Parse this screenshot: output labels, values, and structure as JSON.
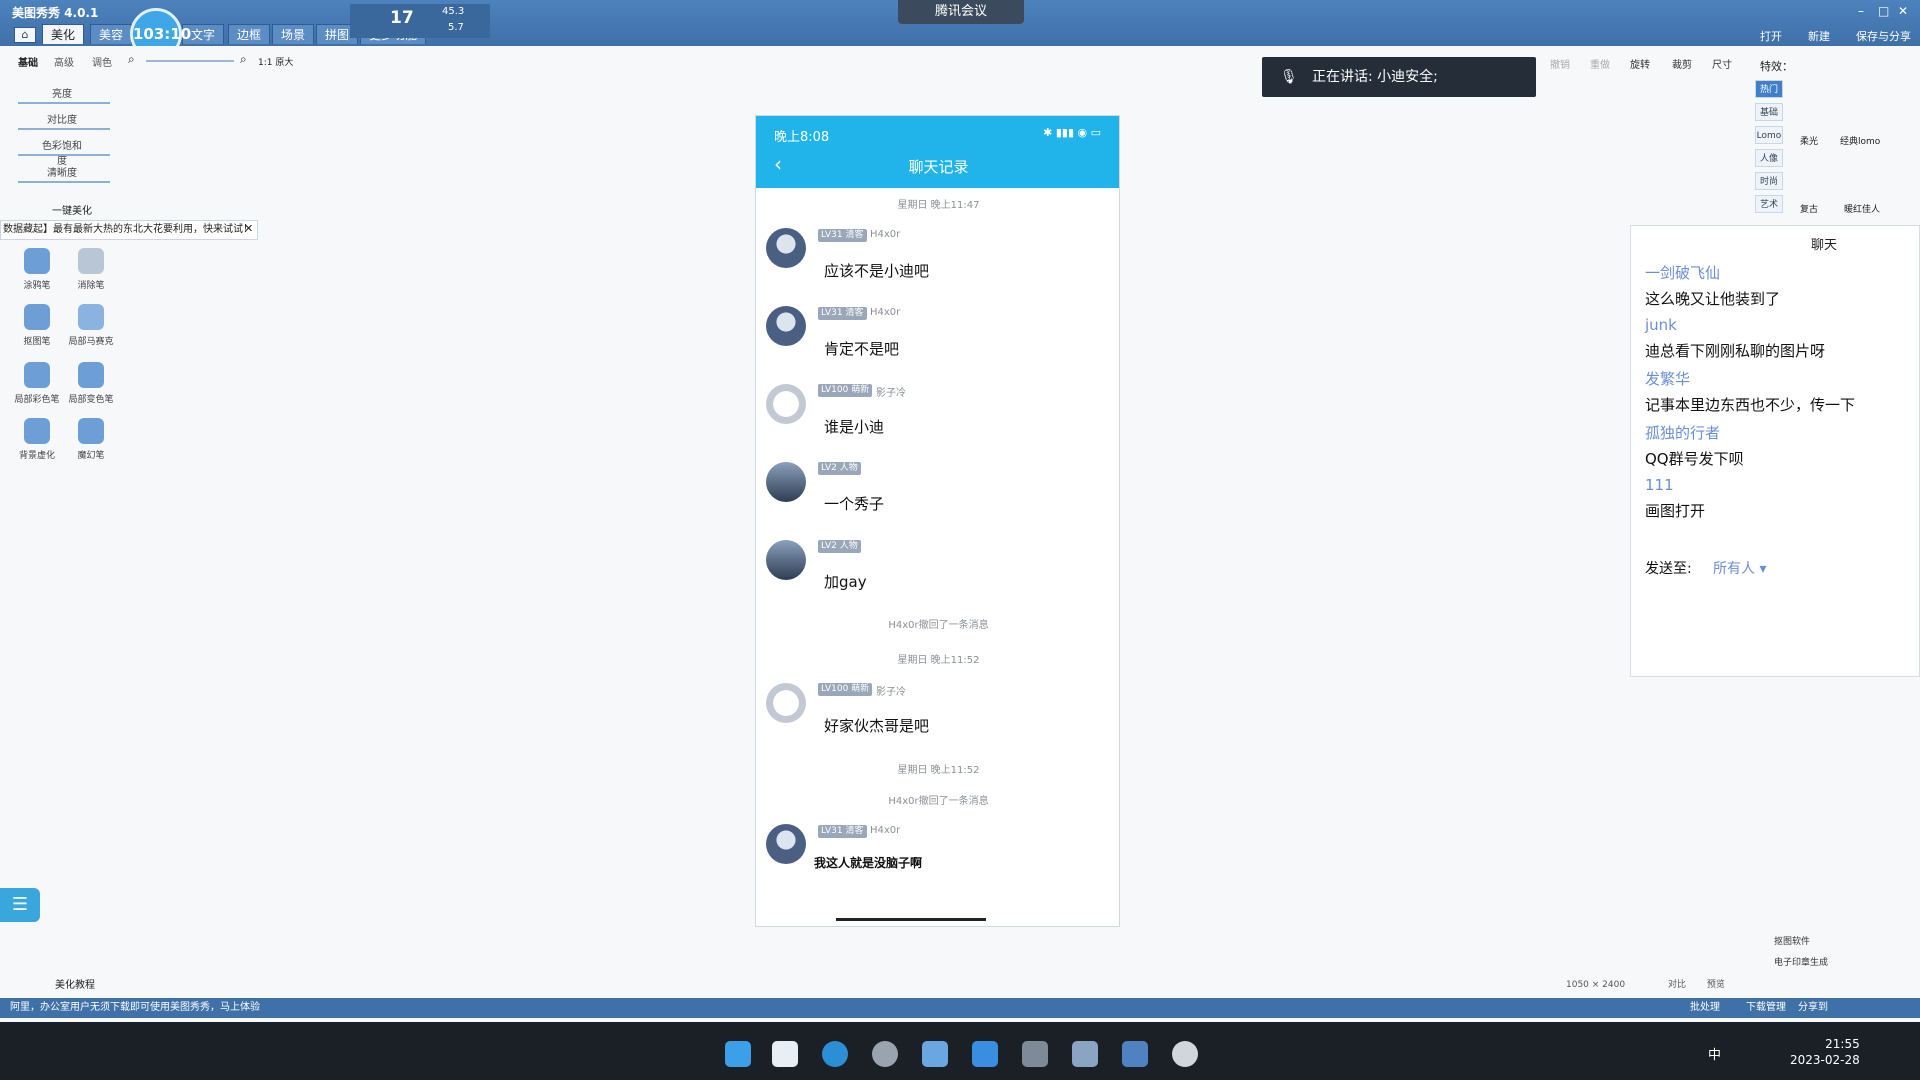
{
  "app": {
    "title": "美图秀秀 4.0.1"
  },
  "menu_tabs": [
    "美化",
    "美容",
    "文字",
    "边框",
    "场景",
    "拼图",
    "更多功能"
  ],
  "timer": "103:10",
  "network": {
    "temp": "17",
    "up": "45.3",
    "down": "5.7"
  },
  "meeting_bar": "腾讯会议",
  "toolbar_right": {
    "open": "打开",
    "new": "新建",
    "save": "保存与分享"
  },
  "left_panel": {
    "subtabs": [
      "基础",
      "高级",
      "调色"
    ],
    "zoom_label": "1:1 原大",
    "sliders": [
      "亮度",
      "对比度",
      "色彩饱和度",
      "清晰度"
    ],
    "one_click": "一键美化",
    "promo": "数据藏起】最有最新大热的东北大花要利用，快来试试！",
    "tools": [
      {
        "label": "涂鸦笔",
        "icon": "brush-icon"
      },
      {
        "label": "消除笔",
        "icon": "eraser-icon"
      },
      {
        "label": "抠图笔",
        "icon": "cutout-icon"
      },
      {
        "label": "局部马赛克",
        "icon": "mosaic-icon"
      },
      {
        "label": "局部彩色笔",
        "icon": "color-pen-icon"
      },
      {
        "label": "局部变色笔",
        "icon": "recolor-icon"
      },
      {
        "label": "背景虚化",
        "icon": "blur-icon"
      },
      {
        "label": "魔幻笔",
        "icon": "magic-wand-icon"
      }
    ],
    "footer": "美化教程"
  },
  "speaking": "正在讲话: 小迪安全;",
  "phone": {
    "time": "晚上8:08",
    "title": "聊天记录",
    "messages": [
      {
        "kind": "ts",
        "text": "星期日 晚上11:47"
      },
      {
        "kind": "msg",
        "badge": "LV31 清客",
        "name": "H4x0r",
        "text": "应该不是小迪吧",
        "avatar": "anime"
      },
      {
        "kind": "msg",
        "badge": "LV31 清客",
        "name": "H4x0r",
        "text": "肯定不是吧",
        "avatar": "anime"
      },
      {
        "kind": "msg",
        "badge": "LV100 萌新",
        "name": "影子冷",
        "text": "谁是小迪",
        "avatar": "cat"
      },
      {
        "kind": "msg",
        "badge": "LV2 人物",
        "name": "",
        "text": "一个秀子",
        "avatar": "scene"
      },
      {
        "kind": "msg",
        "badge": "LV2 人物",
        "name": "",
        "text": "加gay",
        "avatar": "scene"
      },
      {
        "kind": "recall",
        "text": "H4x0r撤回了一条消息"
      },
      {
        "kind": "ts",
        "text": "星期日 晚上11:52"
      },
      {
        "kind": "msg",
        "badge": "LV100 萌新",
        "name": "影子冷",
        "text": "好家伙杰哥是吧",
        "avatar": "cat"
      },
      {
        "kind": "ts",
        "text": "星期日 晚上11:52"
      },
      {
        "kind": "recall",
        "text": "H4x0r撤回了一条消息"
      },
      {
        "kind": "msg",
        "badge": "LV31 清客",
        "name": "H4x0r",
        "text": "我这人就是没脑子啊",
        "avatar": "anime"
      }
    ]
  },
  "right_tools": [
    "撤销",
    "重做",
    "旋转",
    "裁剪",
    "尺寸"
  ],
  "effects": {
    "label": "特效：",
    "categories": [
      "热门",
      "基础",
      "Lomo",
      "人像",
      "时尚",
      "艺术"
    ],
    "names": [
      "柔光",
      "经典lomo",
      "复古",
      "暖红佳人"
    ]
  },
  "chat": {
    "title": "聊天",
    "lines": [
      {
        "name": "一剑破飞仙",
        "msg": "这么晚又让他装到了"
      },
      {
        "name": "junk",
        "msg": "迪总看下刚刚私聊的图片呀"
      },
      {
        "name": "发繁华",
        "msg": "记事本里边东西也不少，传一下"
      },
      {
        "name": "孤独的行者",
        "msg": "QQ群号发下呗"
      },
      {
        "name": "111",
        "msg": "画图打开"
      }
    ],
    "send_label": "发送至:",
    "send_value": "所有人 ▾"
  },
  "right_links": [
    "抠图软件",
    "电子印章生成"
  ],
  "canvas_info": {
    "size": "1050 × 2400",
    "compare": "对比",
    "preview": "预览"
  },
  "status_bar": {
    "left": "阿里，办公室用户无须下载即可使用美图秀秀，马上体验",
    "right1": "批处理",
    "right2": "下载管理",
    "share": "分享到"
  },
  "clock": {
    "time": "21:55",
    "date": "2023-02-28"
  },
  "taskbar_ime": "中"
}
